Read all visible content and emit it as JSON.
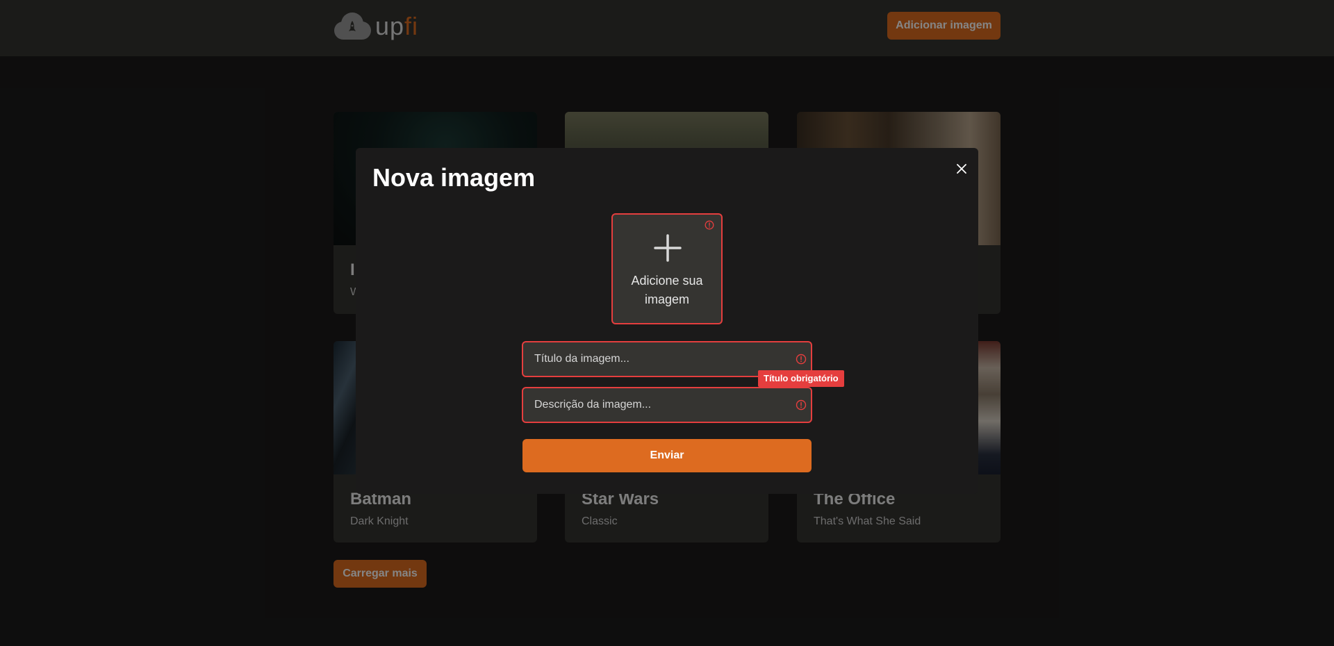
{
  "header": {
    "logo_text": "up",
    "logo_accent": "fi",
    "add_button_label": "Adicionar imagem"
  },
  "cards": [
    {
      "title": "I",
      "description": "W"
    },
    {
      "title": "",
      "description": ""
    },
    {
      "title": "",
      "description": ""
    },
    {
      "title": "Batman",
      "description": "Dark Knight"
    },
    {
      "title": "Star Wars",
      "description": "Classic"
    },
    {
      "title": "The Office",
      "description": "That's What She Said"
    }
  ],
  "load_more_label": "Carregar mais",
  "modal": {
    "title": "Nova imagem",
    "upload_label": "Adicione sua imagem",
    "title_placeholder": "Título da imagem...",
    "title_error": "Título obrigatório",
    "description_placeholder": "Descrição da imagem...",
    "submit_label": "Enviar"
  },
  "colors": {
    "accent": "#dd6b20",
    "error": "#e53e3e",
    "background": "#1b1a1a",
    "surface": "#353431"
  }
}
